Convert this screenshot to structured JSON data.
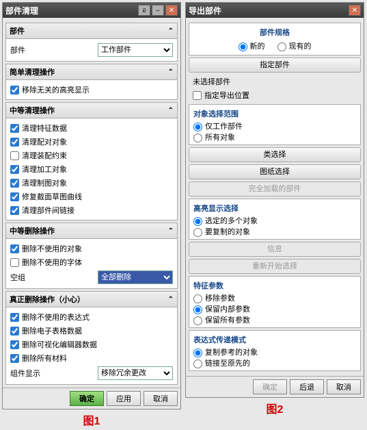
{
  "window1": {
    "title": "部件清理",
    "sections": {
      "bujian": {
        "header": "部件",
        "label": "部件",
        "value": "工作部件"
      },
      "jiandan": {
        "header": "简单清理操作",
        "items": [
          {
            "checked": true,
            "label": "移除无关的高亮显示"
          }
        ]
      },
      "zhongdeng_clean": {
        "header": "中等清理操作",
        "items": [
          {
            "checked": true,
            "label": "清理特征数据"
          },
          {
            "checked": true,
            "label": "清理配对对象"
          },
          {
            "checked": false,
            "label": "清理装配约束"
          },
          {
            "checked": true,
            "label": "清理加工对象"
          },
          {
            "checked": true,
            "label": "清理制图对象"
          },
          {
            "checked": true,
            "label": "修复截面草图曲线"
          },
          {
            "checked": true,
            "label": "清理部件间链接"
          }
        ]
      },
      "zhongdeng_del": {
        "header": "中等删除操作",
        "items": [
          {
            "checked": true,
            "label": "删除不使用的对象"
          },
          {
            "checked": false,
            "label": "删除不使用的字体"
          }
        ],
        "kongzu_label": "空组",
        "kongzu_value": "全部删除"
      },
      "zhenzheng": {
        "header": "真正删除操作（小心）",
        "items": [
          {
            "checked": true,
            "label": "删除不使用的表达式"
          },
          {
            "checked": true,
            "label": "删除电子表格数据"
          },
          {
            "checked": true,
            "label": "删除可视化编辑器数据"
          },
          {
            "checked": true,
            "label": "删除所有材料"
          }
        ],
        "zuijian_label": "组件显示",
        "zuijian_value": "移除冗余更改"
      }
    },
    "footer": {
      "ok": "确定",
      "apply": "应用",
      "cancel": "取消"
    },
    "caption": "图1"
  },
  "window2": {
    "title": "导出部件",
    "spec": {
      "header": "部件规格",
      "opt1": "新的",
      "opt2": "现有的"
    },
    "assign_btn": "指定部件",
    "unselected": "未选择部件",
    "assign_loc": "指定导出位置",
    "range": {
      "header": "对象选择范围",
      "opt1": "仅工作部件",
      "opt2": "所有对象"
    },
    "btns": {
      "class_sel": "类选择",
      "draw_sel": "图纸选择",
      "full_load": "完全加载的部件",
      "info": "信息",
      "restart": "重新开始选择"
    },
    "highlight": {
      "header": "高亮显示选择",
      "opt1": "选定的多个对象",
      "opt2": "要复制的对象"
    },
    "tezheng": {
      "header": "特征参数",
      "opt1": "移除参数",
      "opt2": "保留内部参数",
      "opt3": "保留所有参数"
    },
    "biaodashi": {
      "header": "表达式传递模式",
      "opt1": "复制参考的对象",
      "opt2": "链接至原先的"
    },
    "footer": {
      "ok": "确定",
      "back": "后退",
      "cancel": "取消"
    },
    "caption": "图2"
  }
}
